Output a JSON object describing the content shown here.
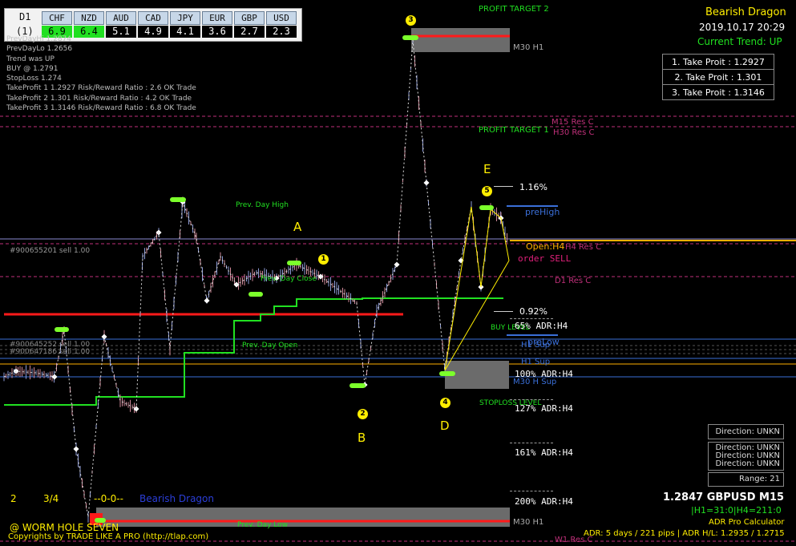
{
  "timeframe": "D1",
  "currency_table": {
    "row_label": "(1)",
    "currencies": [
      "CHF",
      "NZD",
      "AUD",
      "CAD",
      "JPY",
      "EUR",
      "GBP",
      "USD"
    ],
    "values": [
      "6.9",
      "6.4",
      "5.1",
      "4.9",
      "4.1",
      "3.6",
      "2.7",
      "2.3"
    ],
    "highlight_color": "#21e021"
  },
  "info_lines": [
    "PrevDayHi 1.2874",
    "PrevDayLo 1.2656",
    "Trend was UP",
    "BUY @ 1.2791",
    "StopLoss 1.274",
    "TakeProfit 1 1.2927 Risk/Reward Ratio : 2.6 OK Trade",
    "TakeProfit 2 1.301 Risk/Reward Ratio : 4.2 OK Trade",
    "TakeProfit 3 1.3146 Risk/Reward Ratio : 6.8 OK Trade"
  ],
  "top_right": {
    "pattern": "Bearish Dragon",
    "datetime": "2019.10.17 20:29",
    "trend": "Current Trend: UP",
    "take_profits": [
      "1. Take Proit : 1.2927",
      "2. Take Proit : 1.301",
      "3. Take Proit : 1.3146"
    ]
  },
  "levels": {
    "profit_target_2": "PROFIT TARGET 2",
    "profit_target_1": "PROFIT TARGET 1",
    "m30h1_top": "M30 H1",
    "m15_res": "M15 Res C",
    "h30_res": "H30 Res C",
    "h4_res": "H4 Res C",
    "d1_res": "D1 Res C",
    "prev_day_high": "Prev. Day High",
    "prev_day_close": "Prev. Day Close",
    "prev_day_open": "Prev. Day Open",
    "prev_day_low": "Prev. Day Low",
    "buy_level": "BUY LEVEL",
    "stoploss_level": "STOPLOSS LEVEL",
    "h1_sup": "H1 Sup",
    "h1_sup2": "H1 Sup",
    "m30_sup": "M30 H Sup",
    "m30h1_bottom": "M30 H1",
    "w1_res": "W1 Res C",
    "pre_high": "preHigh",
    "pre_low": "preLow",
    "open_h4": "Open:H4",
    "order_sell": "order SELL",
    "sell_order": "#900655201 sell 1.00",
    "order_a": "#900645252 sell 1.00",
    "order_b": "#900647186 sell 1.00"
  },
  "percents": {
    "p1": "1.16%",
    "p2": "0.92%"
  },
  "adr_labels": [
    "65% ADR:H4",
    "100% ADR:H4",
    "127% ADR:H4",
    "161% ADR:H4",
    "200% ADR:H4"
  ],
  "pattern_points": {
    "A": "A",
    "B": "B",
    "D": "D",
    "E": "E"
  },
  "circle_nums": [
    "1",
    "2",
    "3",
    "4",
    "5"
  ],
  "bottom_left": {
    "count_2": "2",
    "count_34": "3/4",
    "zero": "--0-0--",
    "pattern": "Bearish Dragon",
    "brand": "@ WORM HOLE SEVEN",
    "copyright": "Copyrights by TRADE LIKE A PRO (http://tlap.com)"
  },
  "right_panel": {
    "direction_single": "Direction: UNKN",
    "directions": [
      "Direction: UNKN",
      "Direction: UNKN",
      "Direction: UNKN"
    ],
    "range": "Range: 21",
    "price_symbol": "1.2847 GBPUSD M15",
    "hstats": "|H1=31:0|H4=211:0",
    "calc": "ADR Pro Calculator",
    "adr_info": "ADR: 5 days / 221 pips | ADR H/L: 1.2935 / 1.2715"
  },
  "colors": {
    "bg": "#000000",
    "green": "#21e021",
    "red": "#ff1a1a",
    "yellow": "#ffee00",
    "magenta": "#c0307a",
    "blue": "#3a6fd8",
    "orange": "#ffb000"
  }
}
